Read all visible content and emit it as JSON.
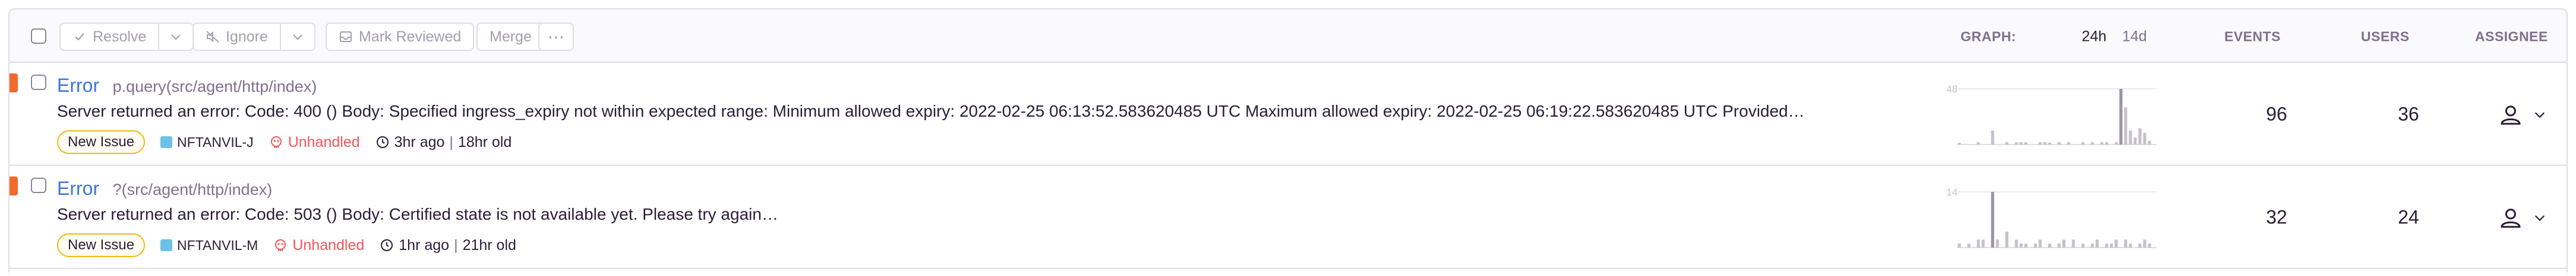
{
  "toolbar": {
    "resolve_label": "Resolve",
    "ignore_label": "Ignore",
    "mark_reviewed_label": "Mark Reviewed",
    "merge_label": "Merge",
    "more_label": "⋯"
  },
  "columns": {
    "graph_label": "GRAPH:",
    "period_24h": "24h",
    "period_14d": "14d",
    "events_label": "EVENTS",
    "users_label": "USERS",
    "assignee_label": "ASSIGNEE"
  },
  "colors": {
    "accent_error": "#f06a2c",
    "link": "#3d74db",
    "unhandled": "#f55459",
    "badge_border": "#f2b712",
    "spark_bar": "#c6c0cc",
    "spark_highlight": "#9b94a3"
  },
  "issues": [
    {
      "type": "Error",
      "culprit": "p.query(src/agent/http/index)",
      "message": "Server returned an error: Code: 400 () Body: Specified ingress_expiry not within expected range: Minimum allowed expiry: 2022-02-25 06:13:52.583620485 UTC Maximum allowed expiry: 2022-02-25 06:19:22.583620485 UTC Provided…",
      "badge": "New Issue",
      "project": "NFTANVIL-J",
      "unhandled": "Unhandled",
      "last_seen": "3hr ago",
      "age": "18hr old",
      "graph_max_label": "48",
      "graph_max": 48,
      "graph_values": [
        0,
        0,
        0,
        0,
        0,
        0,
        0,
        12,
        0,
        0,
        0,
        0,
        0,
        0,
        0,
        0,
        0,
        0,
        0,
        0,
        0,
        0,
        0,
        0,
        0,
        0,
        0,
        0,
        0,
        0,
        0,
        0,
        0,
        0,
        0,
        0,
        0,
        0,
        0,
        0,
        0,
        0,
        0,
        0,
        0,
        0,
        0,
        0,
        0,
        0,
        0,
        0,
        0,
        0,
        0,
        0,
        0,
        0,
        0,
        0,
        0,
        0,
        0,
        0,
        0,
        0,
        0,
        0,
        0,
        0,
        0,
        0,
        0,
        0,
        0,
        0,
        0,
        0,
        0,
        0,
        0,
        0,
        0,
        48,
        32,
        12,
        6,
        12,
        10,
        3
      ],
      "graph_sparse": [
        [
          0,
          1
        ],
        [
          4,
          2
        ],
        [
          7,
          12
        ],
        [
          10,
          2
        ],
        [
          12,
          2
        ],
        [
          13,
          2
        ],
        [
          14,
          2
        ],
        [
          17,
          2
        ],
        [
          18,
          2
        ],
        [
          19,
          1
        ],
        [
          21,
          2
        ],
        [
          23,
          2
        ],
        [
          26,
          2
        ],
        [
          28,
          2
        ],
        [
          30,
          2
        ],
        [
          31,
          2
        ],
        [
          33,
          2
        ],
        [
          34,
          48
        ],
        [
          35,
          32
        ],
        [
          36,
          12
        ],
        [
          37,
          6
        ],
        [
          38,
          14
        ],
        [
          39,
          10
        ],
        [
          40,
          3
        ]
      ],
      "events": "96",
      "users": "36"
    },
    {
      "type": "Error",
      "culprit": "?(src/agent/http/index)",
      "message": "Server returned an error: Code: 503 () Body: Certified state is not available yet. Please try again…",
      "badge": "New Issue",
      "project": "NFTANVIL-M",
      "unhandled": "Unhandled",
      "last_seen": "1hr ago",
      "age": "21hr old",
      "graph_max_label": "14",
      "graph_max": 14,
      "graph_sparse": [
        [
          0,
          1
        ],
        [
          2,
          1
        ],
        [
          4,
          2
        ],
        [
          5,
          2
        ],
        [
          7,
          14
        ],
        [
          8,
          2
        ],
        [
          10,
          4
        ],
        [
          12,
          2
        ],
        [
          13,
          1
        ],
        [
          14,
          1
        ],
        [
          16,
          1
        ],
        [
          17,
          2
        ],
        [
          19,
          1
        ],
        [
          21,
          1
        ],
        [
          22,
          2
        ],
        [
          24,
          2
        ],
        [
          26,
          1
        ],
        [
          28,
          1
        ],
        [
          29,
          2
        ],
        [
          31,
          1
        ],
        [
          32,
          1
        ],
        [
          33,
          2
        ],
        [
          35,
          2
        ],
        [
          36,
          1
        ],
        [
          38,
          1
        ],
        [
          39,
          2
        ],
        [
          40,
          1
        ]
      ],
      "events": "32",
      "users": "24"
    }
  ]
}
